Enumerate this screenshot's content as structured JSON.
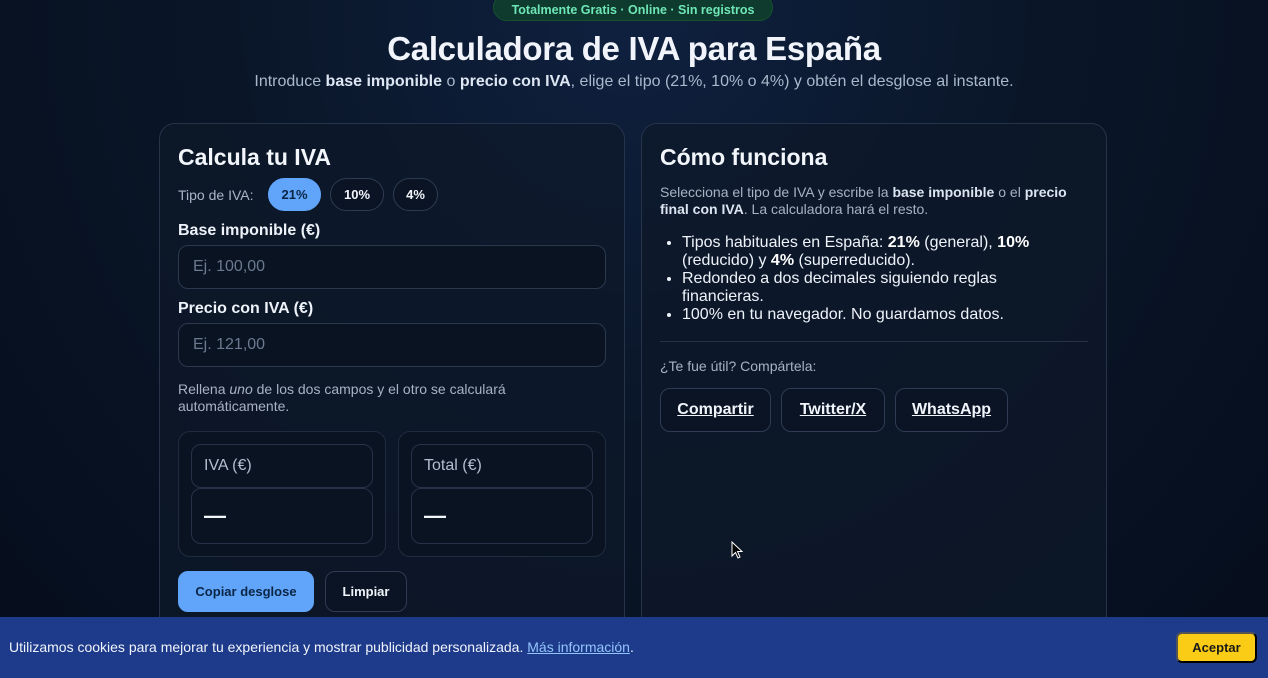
{
  "badge": "Totalmente Gratis · Online · Sin registros",
  "hero": {
    "title": "Calculadora de IVA para España",
    "subtitle": {
      "part1": "Introduce ",
      "bold1": "base imponible",
      "part2": " o ",
      "bold2": "precio con IVA",
      "part3": ", elige el tipo (21%, 10% o 4%) y obtén el desglose al instante."
    }
  },
  "calculator": {
    "title": "Calcula tu IVA",
    "tipo_label": "Tipo de IVA:",
    "rates": [
      {
        "label": "21%",
        "active": true
      },
      {
        "label": "10%",
        "active": false
      },
      {
        "label": "4%",
        "active": false
      }
    ],
    "base_label": "Base imponible (€)",
    "base_placeholder": "Ej. 100,00",
    "base_value": "",
    "precio_label": "Precio con IVA (€)",
    "precio_placeholder": "Ej. 121,00",
    "precio_value": "",
    "hint": {
      "part1": "Rellena ",
      "em": "uno",
      "part2": " de los dos campos y el otro se calculará automáticamente."
    },
    "results": [
      {
        "label": "IVA (€)",
        "value": "—"
      },
      {
        "label": "Total (€)",
        "value": "—"
      }
    ],
    "copy_button": "Copiar desglose",
    "clear_button": "Limpiar"
  },
  "how": {
    "title": "Cómo funciona",
    "intro": {
      "part1": "Selecciona el tipo de IVA y escribe la ",
      "bold1": "base imponible",
      "part2": " o el ",
      "bold2": "precio final con IVA",
      "part3": ". La calculadora hará el resto."
    },
    "bullets": [
      {
        "p1": "Tipos habituales en España: ",
        "b1": "21%",
        "p2": " (general), ",
        "b2": "10%",
        "p3": " (reducido) y ",
        "b3": "4%",
        "p4": " (superreducido)."
      },
      {
        "text": "Redondeo a dos decimales siguiendo reglas financieras."
      },
      {
        "text": "100% en tu navegador. No guardamos datos."
      }
    ],
    "share_label": "¿Te fue útil? Compártela:",
    "share_buttons": [
      "Compartir",
      "Twitter/X",
      "WhatsApp"
    ]
  },
  "cookie": {
    "text": "Utilizamos cookies para mejorar tu experiencia y mostrar publicidad personalizada. ",
    "link": "Más información",
    "after": ".",
    "accept": "Aceptar"
  },
  "colors": {
    "accent": "#60a5fa",
    "badge_text": "#6ee7b7",
    "cookie_bg": "#1e3a8a",
    "accept_button": "#facc15"
  }
}
